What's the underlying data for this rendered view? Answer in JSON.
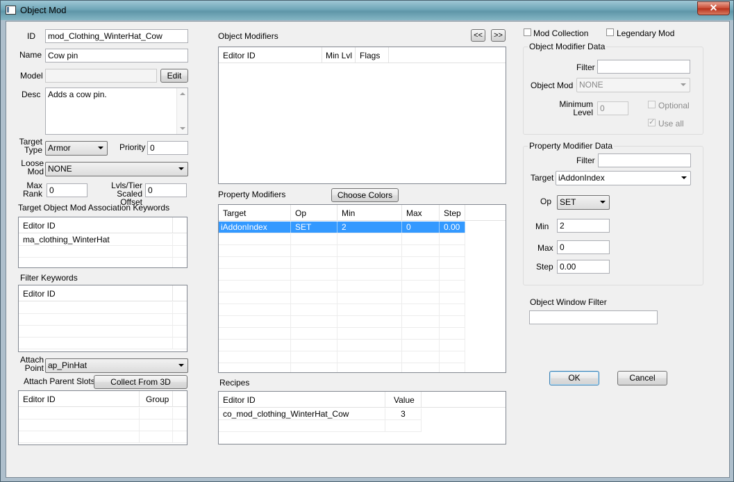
{
  "window": {
    "title": "Object Mod",
    "close_symbol": "✕"
  },
  "left": {
    "id_label": "ID",
    "id_value": "mod_Clothing_WinterHat_Cow",
    "name_label": "Name",
    "name_value": "Cow pin",
    "model_label": "Model",
    "model_value": "",
    "edit_button": "Edit",
    "desc_label": "Desc",
    "desc_value": "Adds a cow pin.",
    "target_type_label1": "Target",
    "target_type_label2": "Type",
    "target_type_value": "Armor",
    "priority_label": "Priority",
    "priority_value": "0",
    "loose_mod_label1": "Loose",
    "loose_mod_label2": "Mod",
    "loose_mod_value": "NONE",
    "max_rank_label1": "Max",
    "max_rank_label2": "Rank",
    "max_rank_value": "0",
    "lvls_label1": "Lvls/Tier",
    "lvls_label2": "Scaled Offset",
    "lvls_value": "0",
    "assoc_keywords_label": "Target Object Mod Association Keywords",
    "assoc_keywords_header": "Editor ID",
    "assoc_keywords_rows": [
      "ma_clothing_WinterHat"
    ],
    "filter_keywords_label": "Filter Keywords",
    "filter_keywords_header": "Editor ID",
    "attach_point_label1": "Attach",
    "attach_point_label2": "Point",
    "attach_point_value": "ap_PinHat",
    "attach_parent_label": "Attach Parent Slots",
    "collect_button": "Collect From 3D",
    "parent_slots_headers": [
      "Editor ID",
      "Group"
    ]
  },
  "middle": {
    "object_modifiers_label": "Object Modifiers",
    "prev_button": "<<",
    "next_button": ">>",
    "object_modifiers_headers": [
      "Editor ID",
      "Min Lvl",
      "Flags"
    ],
    "property_modifiers_label": "Property Modifiers",
    "choose_colors_button": "Choose Colors",
    "property_headers": [
      "Target",
      "Op",
      "Min",
      "Max",
      "Step"
    ],
    "property_rows": [
      [
        "iAddonIndex",
        "SET",
        "2",
        "0",
        "0.00"
      ]
    ],
    "recipes_label": "Recipes",
    "recipes_headers": [
      "Editor ID",
      "Value"
    ],
    "recipes_rows": [
      [
        "co_mod_clothing_WinterHat_Cow",
        "3"
      ]
    ]
  },
  "right": {
    "mod_collection_label": "Mod Collection",
    "legendary_mod_label": "Legendary Mod",
    "omd_title": "Object Modifier Data",
    "omd_filter_label": "Filter",
    "omd_filter_value": "",
    "omd_object_mod_label": "Object Mod",
    "omd_object_mod_value": "NONE",
    "omd_min_level_label1": "Minimum",
    "omd_min_level_label2": "Level",
    "omd_min_level_value": "0",
    "omd_optional_label": "Optional",
    "omd_use_all_label": "Use all",
    "pmd_title": "Property Modifier Data",
    "pmd_filter_label": "Filter",
    "pmd_filter_value": "",
    "pmd_target_label": "Target",
    "pmd_target_value": "iAddonIndex",
    "pmd_op_label": "Op",
    "pmd_op_value": "SET",
    "pmd_min_label": "Min",
    "pmd_min_value": "2",
    "pmd_max_label": "Max",
    "pmd_max_value": "0",
    "pmd_step_label": "Step",
    "pmd_step_value": "0.00",
    "window_filter_label": "Object Window Filter",
    "window_filter_value": "",
    "ok_button": "OK",
    "cancel_button": "Cancel"
  }
}
